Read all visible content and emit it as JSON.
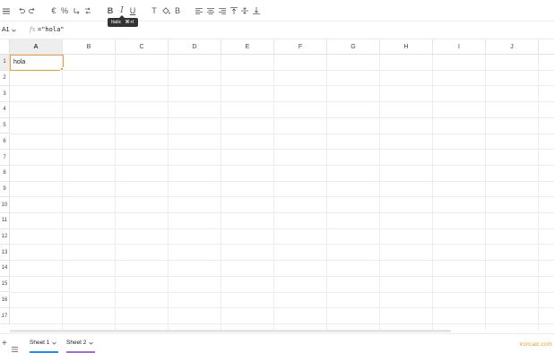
{
  "toolbar": {
    "items": [
      {
        "name": "undo-icon"
      },
      {
        "name": "redo-icon"
      },
      {
        "name": "currency-format-icon",
        "glyph": "€"
      },
      {
        "name": "percent-format-icon",
        "glyph": "%"
      },
      {
        "name": "decrease-decimals-icon"
      },
      {
        "name": "increase-decimals-icon"
      },
      {
        "name": "bold-icon",
        "glyph": "B"
      },
      {
        "name": "italic-icon",
        "glyph": "I"
      },
      {
        "name": "underline-icon",
        "glyph": "U"
      },
      {
        "name": "text-color-icon",
        "glyph": "T"
      },
      {
        "name": "fill-color-icon"
      },
      {
        "name": "borders-icon",
        "glyph": "B"
      },
      {
        "name": "align-left-icon"
      },
      {
        "name": "align-center-icon"
      },
      {
        "name": "align-right-icon"
      },
      {
        "name": "valign-top-icon"
      },
      {
        "name": "valign-middle-icon"
      },
      {
        "name": "valign-bottom-icon"
      }
    ],
    "tooltip": {
      "label": "Italic",
      "shortcut": "⌘+I"
    }
  },
  "formula_bar": {
    "cell_ref": "A1",
    "fx_label": "fx",
    "formula": "=\"hola\""
  },
  "grid": {
    "columns": [
      "A",
      "B",
      "C",
      "D",
      "E",
      "F",
      "G",
      "H",
      "I",
      "J"
    ],
    "rows": [
      "1",
      "2",
      "3",
      "4",
      "5",
      "6",
      "7",
      "8",
      "9",
      "10",
      "11",
      "12",
      "13",
      "14",
      "15",
      "16",
      "17"
    ],
    "selected_cell": "A1",
    "cells": {
      "A1": "hola"
    }
  },
  "sheets": [
    {
      "label": "Sheet 1",
      "color": "#1f8cf0",
      "active": true
    },
    {
      "label": "Sheet 2",
      "color": "#a16bd9",
      "active": false
    }
  ],
  "brand": "ironcalc.com",
  "colors": {
    "accent": "#f29b38"
  }
}
